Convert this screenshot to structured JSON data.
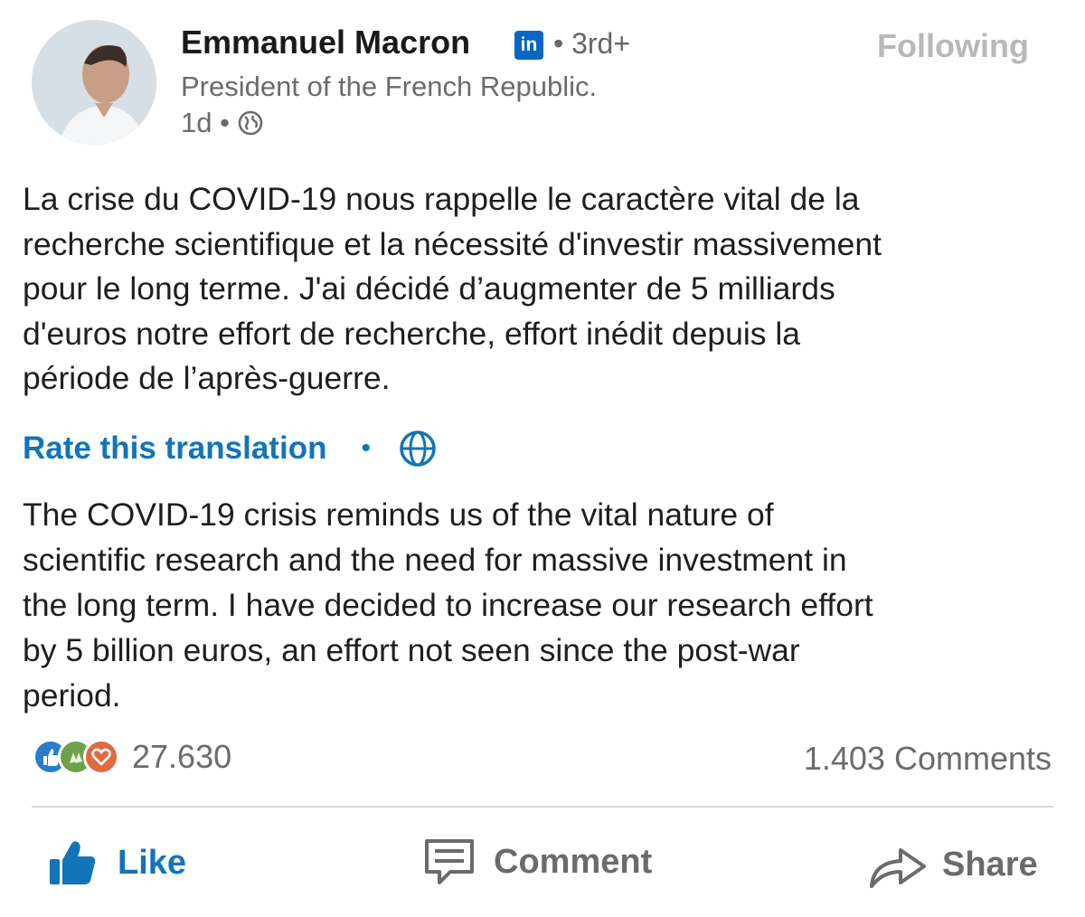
{
  "author": {
    "name": "Emmanuel Macron",
    "badge": "in",
    "degree": "• 3rd+",
    "headline": "President of the French Republic.",
    "time": "1d •",
    "follow_label": "Following"
  },
  "post": {
    "text": "La crise du COVID-19 nous rappelle le caractère vital de la\nrecherche scientifique et la nécessité d'investir massivement\npour le long terme. J'ai décidé d’augmenter de 5 milliards\nd'euros notre effort de recherche, effort inédit depuis la\npériode de l’après-guerre.",
    "rate_translation": "Rate this translation",
    "rate_separator": "•",
    "translation": "The COVID-19 crisis reminds us of the vital nature of\nscientific research and the need for massive investment in\nthe long term. I have decided to increase our research effort\nby 5 billion euros, an effort not seen since the post-war\nperiod."
  },
  "social": {
    "reaction_count": "27.630",
    "comments": "1.403 Comments"
  },
  "actions": {
    "like": "Like",
    "comment": "Comment",
    "share": "Share"
  },
  "colors": {
    "link_blue": "#1274b9",
    "linkedin_blue": "#0a66c2",
    "muted_gray": "#6b6b6b"
  },
  "icons": [
    "linkedin-icon",
    "globe-icon",
    "like-reaction-icon",
    "celebrate-reaction-icon",
    "love-reaction-icon",
    "thumbs-up-icon",
    "comment-icon",
    "share-icon"
  ]
}
